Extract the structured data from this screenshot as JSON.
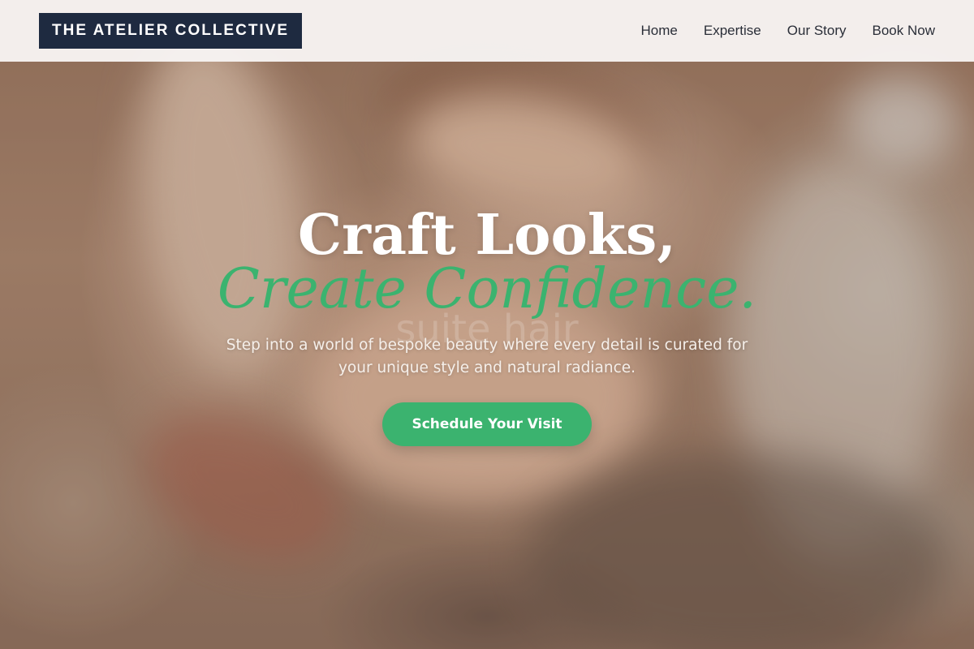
{
  "header": {
    "brand": "THE ATELIER COLLECTIVE",
    "nav": [
      {
        "label": "Home"
      },
      {
        "label": "Expertise"
      },
      {
        "label": "Our Story"
      },
      {
        "label": "Book Now"
      }
    ]
  },
  "hero": {
    "headline_line1": "Craft Looks,",
    "headline_line2": "Create Confidence.",
    "watermark": "suite hair",
    "subtext": "Step into a world of bespoke beauty where every detail is curated for your unique style and natural radiance.",
    "cta_label": "Schedule Your Visit"
  },
  "colors": {
    "brand_bg": "#1e2a40",
    "accent_green": "#3bb36f",
    "header_bg": "#f7f4f2",
    "nav_text": "#2a2e38"
  }
}
